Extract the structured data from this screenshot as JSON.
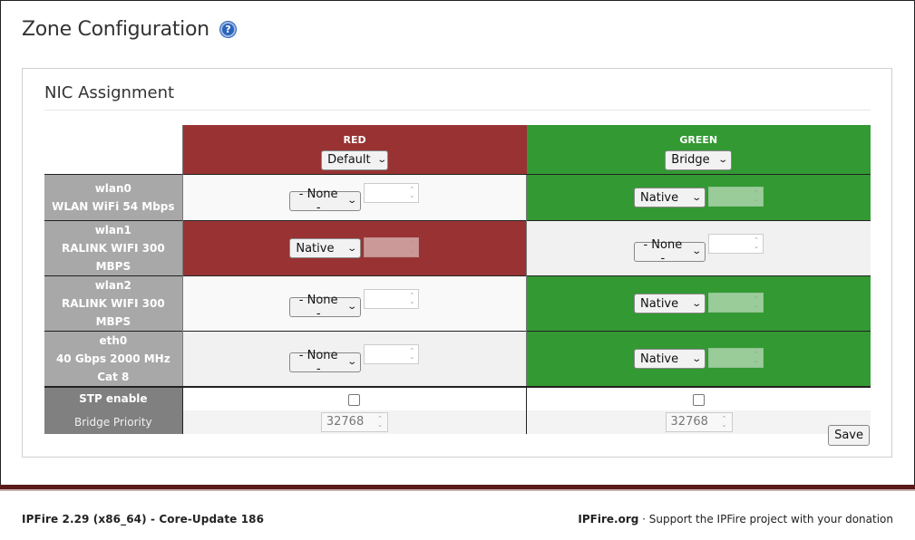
{
  "page": {
    "title": "Zone Configuration",
    "help_icon": "question-icon"
  },
  "section": {
    "title": "NIC Assignment"
  },
  "zones": [
    {
      "name": "RED",
      "mode": "Default",
      "color": "#993333"
    },
    {
      "name": "GREEN",
      "mode": "Bridge",
      "color": "#339933"
    }
  ],
  "nics": [
    {
      "name": "wlan0",
      "desc": "WLAN WiFi 54 Mbps",
      "red": "- None -",
      "green": "Native"
    },
    {
      "name": "wlan1",
      "desc": "RALINK WIFI 300 MBPS",
      "red": "Native",
      "green": "- None -"
    },
    {
      "name": "wlan2",
      "desc": "RALINK WIFI 300 MBPS",
      "red": "- None -",
      "green": "Native"
    },
    {
      "name": "eth0",
      "desc": "40 Gbps 2000 MHz Cat 8",
      "red": "- None -",
      "green": "Native"
    }
  ],
  "stp": {
    "label": "STP enable",
    "priority_label": "Bridge Priority",
    "red_priority": "32768",
    "green_priority": "32768"
  },
  "save_label": "Save",
  "footer": {
    "left": "IPFire 2.29 (x86_64) - Core-Update 186",
    "right_link": "IPFire.org",
    "right_text": " · Support the IPFire project with your donation"
  }
}
